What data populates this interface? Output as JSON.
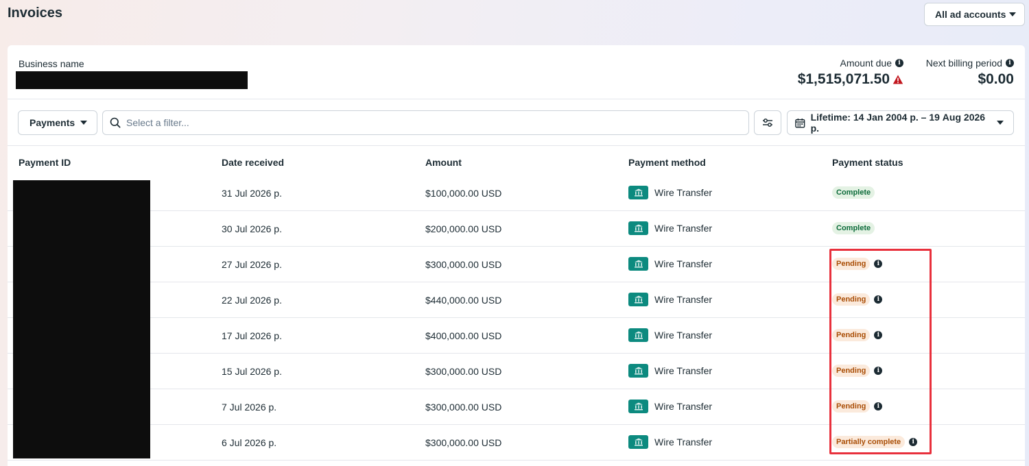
{
  "header": {
    "title": "Invoices",
    "accounts_selector": "All ad accounts"
  },
  "summary": {
    "business_name_label": "Business name",
    "amount_due_label": "Amount due",
    "amount_due_value": "$1,515,071.50",
    "next_billing_label": "Next billing period",
    "next_billing_value": "$0.00"
  },
  "toolbar": {
    "payments_label": "Payments",
    "search_placeholder": "Select a filter...",
    "date_range_label": "Lifetime: 14 Jan 2004 р. – 19 Aug 2026 р."
  },
  "table": {
    "columns": [
      "Payment ID",
      "Date received",
      "Amount",
      "Payment method",
      "Payment status"
    ],
    "rows": [
      {
        "date": "31 Jul 2026 р.",
        "amount": "$100,000.00 USD",
        "method": "Wire Transfer",
        "status": "Complete",
        "status_type": "complete",
        "info": false
      },
      {
        "date": "30 Jul 2026 р.",
        "amount": "$200,000.00 USD",
        "method": "Wire Transfer",
        "status": "Complete",
        "status_type": "complete",
        "info": false
      },
      {
        "date": "27 Jul 2026 р.",
        "amount": "$300,000.00 USD",
        "method": "Wire Transfer",
        "status": "Pending",
        "status_type": "pending",
        "info": true
      },
      {
        "date": "22 Jul 2026 р.",
        "amount": "$440,000.00 USD",
        "method": "Wire Transfer",
        "status": "Pending",
        "status_type": "pending",
        "info": true
      },
      {
        "date": "17 Jul 2026 р.",
        "amount": "$400,000.00 USD",
        "method": "Wire Transfer",
        "status": "Pending",
        "status_type": "pending",
        "info": true
      },
      {
        "date": "15 Jul 2026 р.",
        "amount": "$300,000.00 USD",
        "method": "Wire Transfer",
        "status": "Pending",
        "status_type": "pending",
        "info": true
      },
      {
        "date": "7 Jul 2026 р.",
        "amount": "$300,000.00 USD",
        "method": "Wire Transfer",
        "status": "Pending",
        "status_type": "pending",
        "info": true
      },
      {
        "date": "6 Jul 2026 р.",
        "amount": "$300,000.00 USD",
        "method": "Wire Transfer",
        "status": "Partially complete",
        "status_type": "partial",
        "info": true
      }
    ]
  },
  "colors": {
    "complete_badge_bg": "#e4f2e4",
    "complete_badge_text": "#0c6b3a",
    "pending_badge_bg": "#fbeadc",
    "pending_badge_text": "#a94d05",
    "bank_icon": "#0c8a7f",
    "highlight_box": "#e8303c",
    "warning_icon": "#c2171f"
  }
}
